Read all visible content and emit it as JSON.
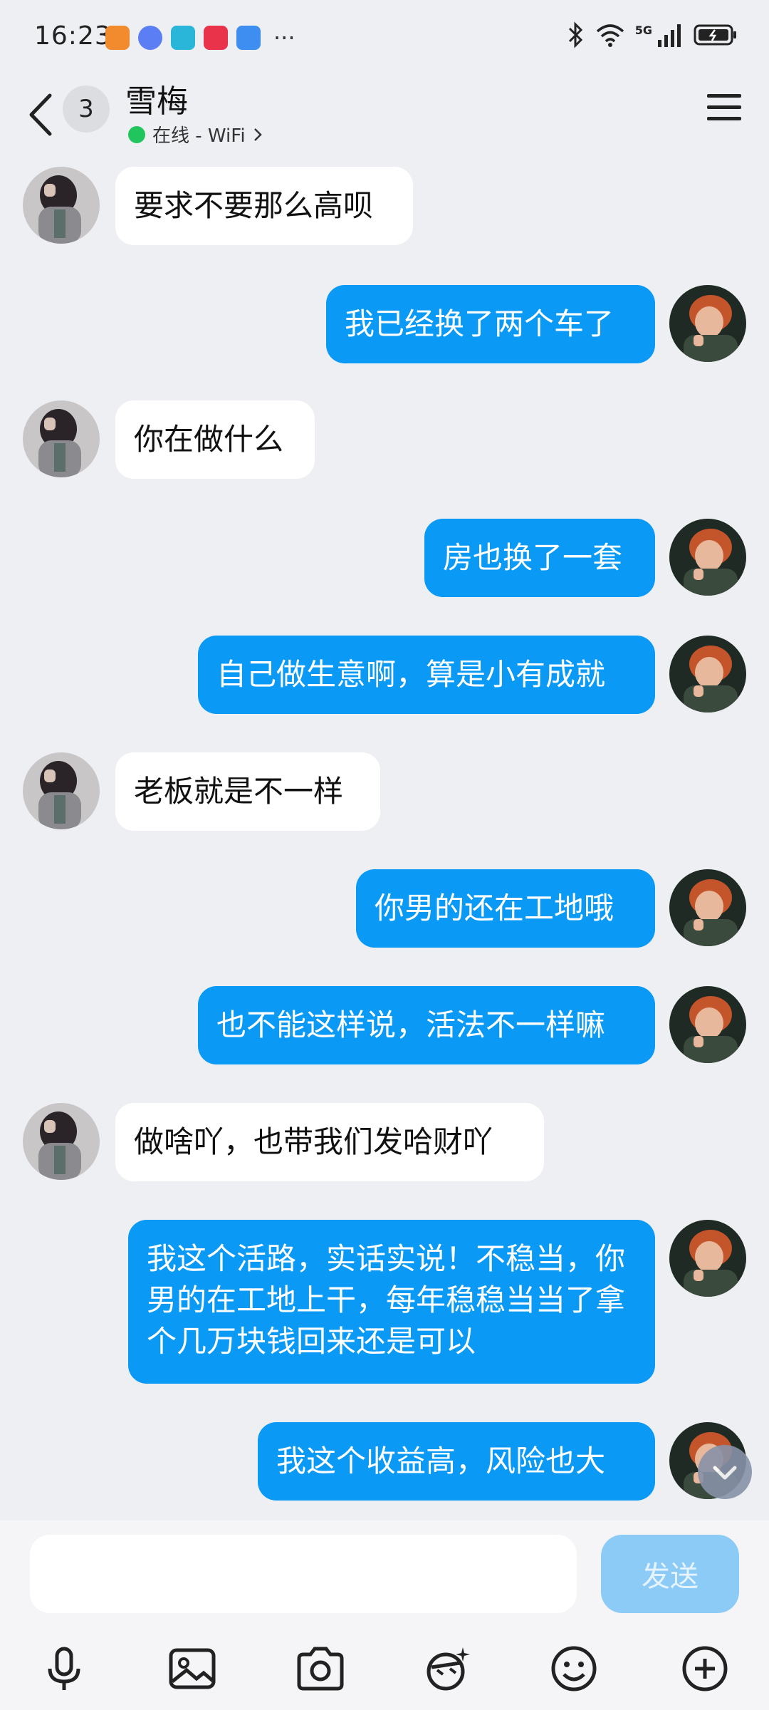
{
  "status_bar": {
    "time": "16:23",
    "network": "5G",
    "icons": [
      "app-icon-orange",
      "app-icon-blue",
      "app-icon-book",
      "app-icon-video",
      "app-icon-cloud",
      "bluetooth-icon",
      "wifi-icon",
      "signal-icon",
      "battery-icon"
    ],
    "more": "···"
  },
  "header": {
    "back_label": "<",
    "unread_count": "3",
    "name": "雪梅",
    "status": "在线 - WiFi",
    "status_color": "#21c55d"
  },
  "messages": [
    {
      "side": "in",
      "text": "要求不要那么高呗"
    },
    {
      "side": "out",
      "text": "我已经换了两个车了"
    },
    {
      "side": "in",
      "text": "你在做什么"
    },
    {
      "side": "out",
      "text": "房也换了一套"
    },
    {
      "side": "out",
      "text": "自己做生意啊，算是小有成就"
    },
    {
      "side": "in",
      "text": "老板就是不一样"
    },
    {
      "side": "out",
      "text": "你男的还在工地哦"
    },
    {
      "side": "out",
      "text": "也不能这样说，活法不一样嘛"
    },
    {
      "side": "in",
      "text": "做啥吖，也带我们发哈财吖"
    },
    {
      "side": "out",
      "text": "我这个活路，实话实说！不稳当，你男的在工地上干，每年稳稳当当了拿个几万块钱回来还是可以"
    },
    {
      "side": "out",
      "text": "我这个收益高，风险也大"
    }
  ],
  "input": {
    "value": "",
    "send_label": "发送"
  },
  "toolbar": [
    "microphone-icon",
    "image-icon",
    "camera-icon",
    "sticker-icon",
    "emoji-icon",
    "plus-icon"
  ],
  "colors": {
    "outgoing_bubble": "#0a99f5",
    "incoming_bubble": "#ffffff",
    "background": "#eeeff3",
    "send_button": "#8dcbf7"
  }
}
